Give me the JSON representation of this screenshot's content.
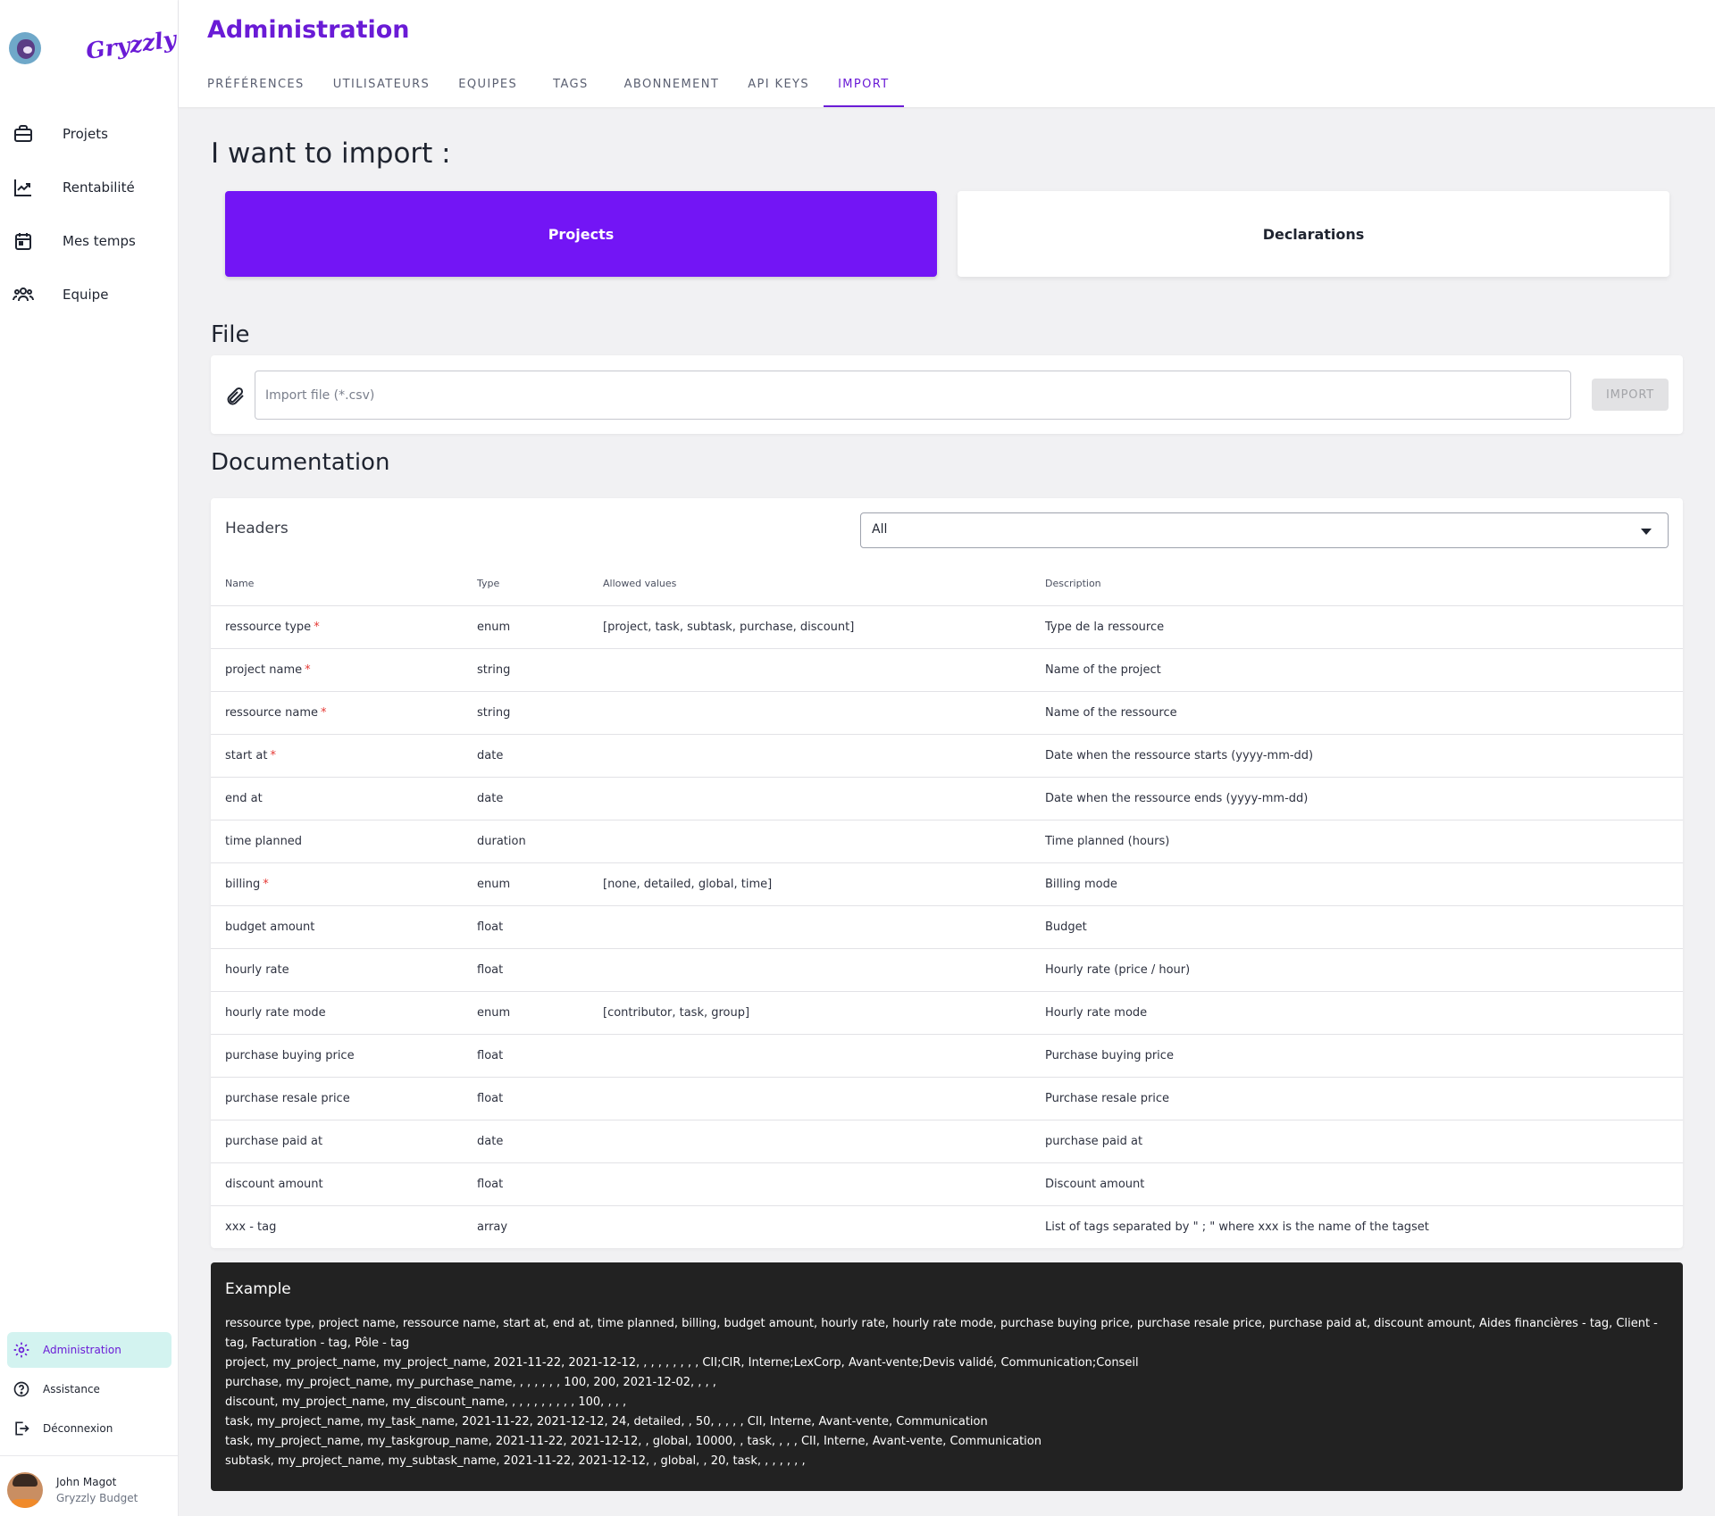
{
  "sidebar": {
    "logo_text": "Gryzzly",
    "nav": [
      {
        "label": "Projets",
        "icon": "briefcase-icon"
      },
      {
        "label": "Rentabilité",
        "icon": "trend-chart-icon"
      },
      {
        "label": "Mes temps",
        "icon": "calendar-icon"
      },
      {
        "label": "Equipe",
        "icon": "team-icon"
      }
    ],
    "bottom": [
      {
        "label": "Administration",
        "icon": "gear-icon",
        "active": true
      },
      {
        "label": "Assistance",
        "icon": "help-icon"
      },
      {
        "label": "Déconnexion",
        "icon": "logout-icon"
      }
    ],
    "user": {
      "name": "John Magot",
      "org": "Gryzzly Budget"
    }
  },
  "header": {
    "title": "Administration",
    "tabs": [
      {
        "label": "PRÉFÉRENCES"
      },
      {
        "label": "UTILISATEURS"
      },
      {
        "label": "EQUIPES"
      },
      {
        "label": "TAGS"
      },
      {
        "label": "ABONNEMENT"
      },
      {
        "label": "API KEYS"
      },
      {
        "label": "IMPORT",
        "active": true
      }
    ]
  },
  "main": {
    "import_heading": "I want to import :",
    "choices": {
      "projects": "Projects",
      "declarations": "Declarations"
    },
    "file_heading": "File",
    "file_placeholder": "Import file (*.csv)",
    "import_button": "IMPORT",
    "doc_heading": "Documentation",
    "headers_label": "Headers",
    "filter_value": "All",
    "columns": {
      "name": "Name",
      "type": "Type",
      "allowed": "Allowed values",
      "description": "Description"
    },
    "rows": [
      {
        "name": "ressource type",
        "required": true,
        "type": "enum",
        "allowed": "[project, task, subtask, purchase, discount]",
        "description": "Type de la ressource"
      },
      {
        "name": "project name",
        "required": true,
        "type": "string",
        "allowed": "",
        "description": "Name of the project"
      },
      {
        "name": "ressource name",
        "required": true,
        "type": "string",
        "allowed": "",
        "description": "Name of the ressource"
      },
      {
        "name": "start at",
        "required": true,
        "type": "date",
        "allowed": "",
        "description": "Date when the ressource starts (yyyy-mm-dd)"
      },
      {
        "name": "end at",
        "required": false,
        "type": "date",
        "allowed": "",
        "description": "Date when the ressource ends (yyyy-mm-dd)"
      },
      {
        "name": "time planned",
        "required": false,
        "type": "duration",
        "allowed": "",
        "description": "Time planned (hours)"
      },
      {
        "name": "billing",
        "required": true,
        "type": "enum",
        "allowed": "[none, detailed, global, time]",
        "description": "Billing mode"
      },
      {
        "name": "budget amount",
        "required": false,
        "type": "float",
        "allowed": "",
        "description": "Budget"
      },
      {
        "name": "hourly rate",
        "required": false,
        "type": "float",
        "allowed": "",
        "description": "Hourly rate (price / hour)"
      },
      {
        "name": "hourly rate mode",
        "required": false,
        "type": "enum",
        "allowed": "[contributor, task, group]",
        "description": "Hourly rate mode"
      },
      {
        "name": "purchase buying price",
        "required": false,
        "type": "float",
        "allowed": "",
        "description": "Purchase buying price"
      },
      {
        "name": "purchase resale price",
        "required": false,
        "type": "float",
        "allowed": "",
        "description": "Purchase resale price"
      },
      {
        "name": "purchase paid at",
        "required": false,
        "type": "date",
        "allowed": "",
        "description": "purchase paid at"
      },
      {
        "name": "discount amount",
        "required": false,
        "type": "float",
        "allowed": "",
        "description": "Discount amount"
      },
      {
        "name": "xxx - tag",
        "required": false,
        "type": "array",
        "allowed": "",
        "description": "List of tags separated by \" ; \" where xxx is the name of the tagset"
      }
    ],
    "example_title": "Example",
    "example_lines": [
      "ressource type, project name, ressource name, start at, end at, time planned, billing, budget amount, hourly rate, hourly rate mode, purchase buying price, purchase resale price, purchase paid at, discount amount, Aides financières - tag, Client - tag, Facturation - tag, Pôle - tag",
      "project, my_project_name, my_project_name, 2021-11-22, 2021-12-12, , , , , , , , , CII;CIR, Interne;LexCorp, Avant-vente;Devis validé, Communication;Conseil",
      "purchase, my_project_name, my_purchase_name, , , , , , , 100, 200, 2021-12-02, , , ,",
      "discount, my_project_name, my_discount_name, , , , , , , , , , 100, , , ,",
      "task, my_project_name, my_task_name, 2021-11-22, 2021-12-12, 24, detailed, , 50, , , , , CII, Interne, Avant-vente, Communication",
      "task, my_project_name, my_taskgroup_name, 2021-11-22, 2021-12-12, , global, 10000, , task, , , , CII, Interne, Avant-vente, Communication",
      "subtask, my_project_name, my_subtask_name, 2021-11-22, 2021-12-12, , global, , 20, task, , , , , , ,"
    ]
  }
}
